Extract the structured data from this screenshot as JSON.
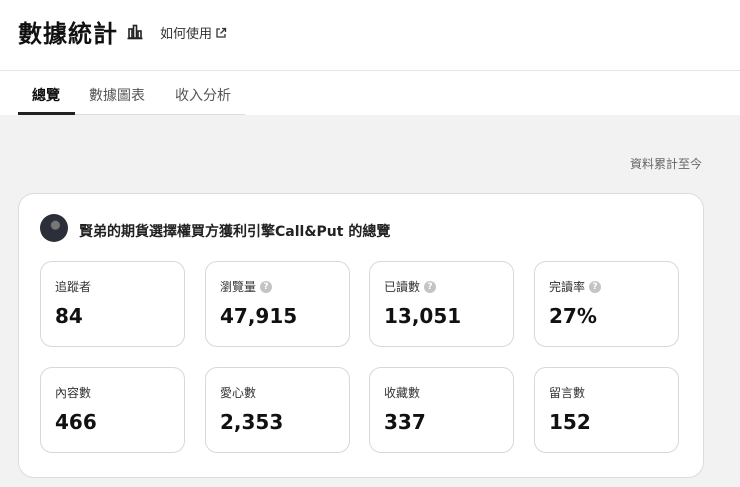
{
  "header": {
    "title": "數據統計",
    "help_link": "如何使用"
  },
  "tabs": [
    {
      "label": "總覽",
      "active": true
    },
    {
      "label": "數據圖表",
      "active": false
    },
    {
      "label": "收入分析",
      "active": false
    }
  ],
  "overview": {
    "cumulative_note": "資料累計至今",
    "channel_title": "賢弟的期貨選擇權買方獲利引擎Call&Put 的總覽",
    "stats": [
      {
        "label": "追蹤者",
        "value": "84",
        "help": false
      },
      {
        "label": "瀏覽量",
        "value": "47,915",
        "help": true
      },
      {
        "label": "已讀數",
        "value": "13,051",
        "help": true
      },
      {
        "label": "完讀率",
        "value": "27%",
        "help": true
      },
      {
        "label": "內容數",
        "value": "466",
        "help": false
      },
      {
        "label": "愛心數",
        "value": "2,353",
        "help": false
      },
      {
        "label": "收藏數",
        "value": "337",
        "help": false
      },
      {
        "label": "留言數",
        "value": "152",
        "help": false
      }
    ]
  },
  "colors": {
    "background": "#f2f2f2",
    "active_tab": "#222222",
    "help_icon": "#c4c4c4"
  }
}
